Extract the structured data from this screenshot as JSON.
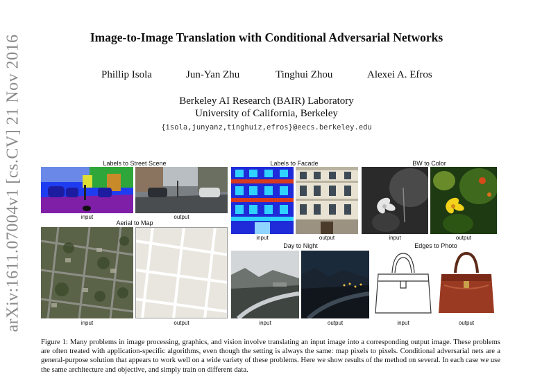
{
  "title": "Image-to-Image Translation with Conditional Adversarial Networks",
  "authors": [
    "Phillip Isola",
    "Jun-Yan Zhu",
    "Tinghui Zhou",
    "Alexei A. Efros"
  ],
  "affiliation": {
    "line1": "Berkeley AI Research (BAIR) Laboratory",
    "line2": "University of California, Berkeley"
  },
  "email": "{isola,junyanz,tinghuiz,efros}@eecs.berkeley.edu",
  "arxiv_stamp": "arXiv:1611.07004v1  [cs.CV]  21 Nov 2016",
  "figure": {
    "panels": [
      {
        "title": "Labels to Street Scene",
        "input": "input",
        "output": "output"
      },
      {
        "title": "Labels to Facade",
        "input": "input",
        "output": "output"
      },
      {
        "title": "BW to Color",
        "input": "input",
        "output": "output"
      },
      {
        "title": "Aerial to Map",
        "input": "input",
        "output": "output"
      },
      {
        "title": "Day to Night",
        "input": "input",
        "output": "output"
      },
      {
        "title": "Edges to Photo",
        "input": "input",
        "output": "output"
      }
    ],
    "caption": "Figure 1: Many problems in image processing, graphics, and vision involve translating an input image into a corresponding output image. These problems are often treated with application-specific algorithms, even though the setting is always the same: map pixels to pixels. Conditional adversarial nets are a general-purpose solution that appears to work well on a wide variety of these problems. Here we show results of the method on several. In each case we use the same architecture and objective, and simply train on different data."
  }
}
